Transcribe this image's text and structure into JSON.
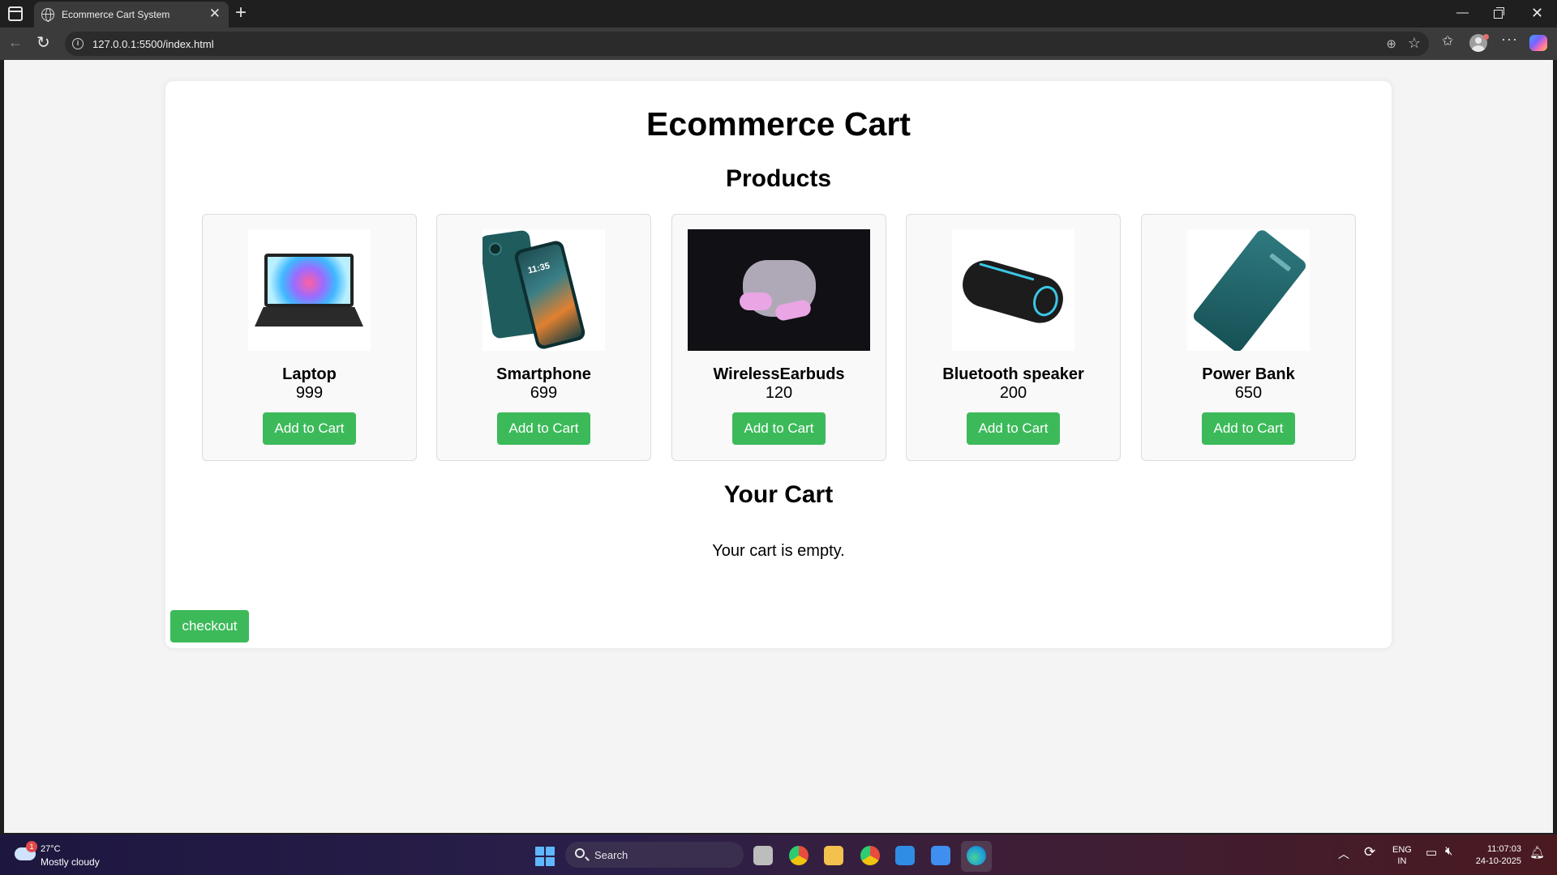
{
  "browser": {
    "tab_title": "Ecommerce Cart System",
    "tab_close": "✕",
    "new_tab": "+",
    "url": "127.0.0.1:5500/index.html",
    "window_controls": {
      "minimize": "—",
      "close": "✕"
    }
  },
  "page": {
    "title": "Ecommerce Cart",
    "products_heading": "Products",
    "cart_heading": "Your Cart",
    "cart_empty_message": "Your cart is empty.",
    "checkout_label": "checkout",
    "accent_color": "#3cba5a"
  },
  "products": [
    {
      "name": "Laptop",
      "price": "999",
      "button": "Add to Cart",
      "image_icon": "laptop-image"
    },
    {
      "name": "Smartphone",
      "price": "699",
      "button": "Add to Cart",
      "image_icon": "smartphone-image"
    },
    {
      "name": "WirelessEarbuds",
      "price": "120",
      "button": "Add to Cart",
      "image_icon": "earbuds-image"
    },
    {
      "name": "Bluetooth speaker",
      "price": "200",
      "button": "Add to Cart",
      "image_icon": "speaker-image"
    },
    {
      "name": "Power Bank",
      "price": "650",
      "button": "Add to Cart",
      "image_icon": "power-bank-image"
    }
  ],
  "taskbar": {
    "weather_badge": "1",
    "weather_temp": "27°C",
    "weather_desc": "Mostly cloudy",
    "search_label": "Search",
    "lang_top": "ENG",
    "lang_bottom": "IN",
    "time": "11:07:03",
    "date": "24-10-2025"
  }
}
